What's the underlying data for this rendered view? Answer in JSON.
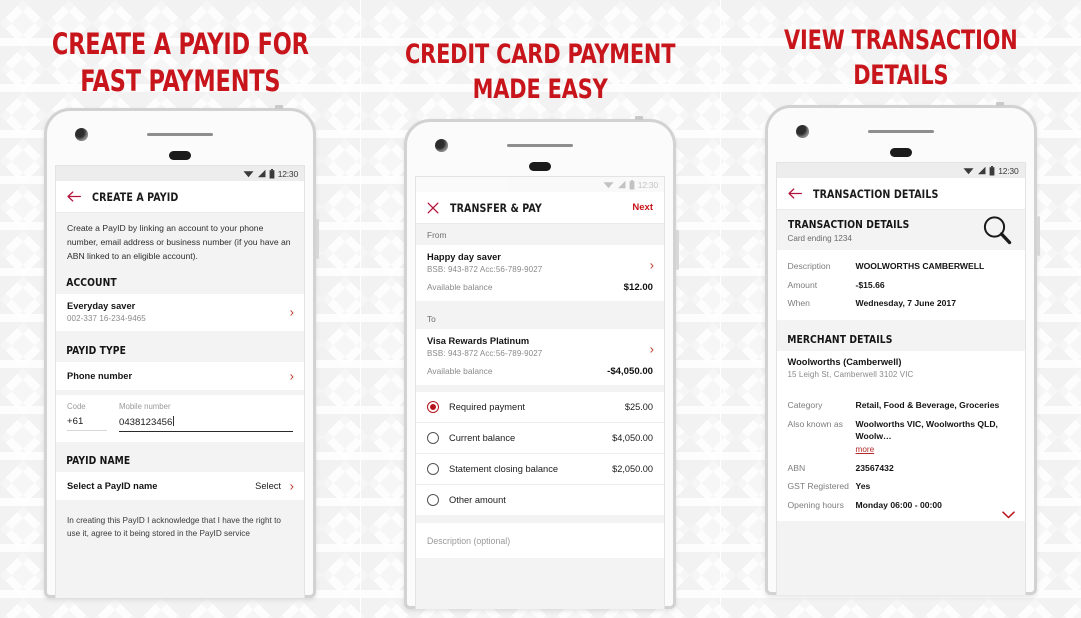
{
  "theme": {
    "brand_red": "#c7151b",
    "accent_red": "#b8131b",
    "chevron_red": "#c0392b"
  },
  "panels": [
    {
      "headline": "CREATE A PAYID FOR\nFAST PAYMENTS",
      "status": {
        "time": "12:30",
        "faded": false
      },
      "appbar": {
        "nav_icon": "back-arrow-icon",
        "title": "CREATE A PAYID",
        "action": ""
      },
      "intro": "Create a PayID by linking an account to your phone number, email address or business number (if you have an ABN linked to an eligible account).",
      "account_section": "ACCOUNT",
      "account": {
        "name": "Everyday saver",
        "detail": "002-337  16-234-9465"
      },
      "payid_type_section": "PAYID TYPE",
      "payid_type": {
        "name": "Phone number"
      },
      "code_label": "Code",
      "code_value": "+61",
      "mobile_label": "Mobile number",
      "mobile_value": "0438123456",
      "payid_name_section": "PAYID NAME",
      "payid_name": {
        "label": "Select a PayID name",
        "action": "Select"
      },
      "legal": "In creating this PayID I acknowledge that I have the right to use it, agree to it being stored in the PayID service"
    },
    {
      "headline": "CREDIT CARD PAYMENT\nMADE EASY",
      "status": {
        "time": "12:30",
        "faded": true
      },
      "appbar": {
        "nav_icon": "close-icon",
        "title": "TRANSFER & PAY",
        "action": "Next"
      },
      "from_label": "From",
      "from_account": {
        "name": "Happy day saver",
        "detail": "BSB: 943-872   Acc:56-789-9027",
        "balance_label": "Available balance",
        "balance": "$12.00"
      },
      "to_label": "To",
      "to_account": {
        "name": "Visa Rewards Platinum",
        "detail": "BSB: 943-872   Acc:56-789-9027",
        "balance_label": "Available balance",
        "balance": "-$4,050.00"
      },
      "options": [
        {
          "label": "Required payment",
          "amount": "$25.00",
          "selected": true
        },
        {
          "label": "Current balance",
          "amount": "$4,050.00",
          "selected": false
        },
        {
          "label": "Statement closing balance",
          "amount": "$2,050.00",
          "selected": false
        },
        {
          "label": "Other amount",
          "amount": "",
          "selected": false
        }
      ],
      "description_placeholder": "Description (optional)"
    },
    {
      "headline": "VIEW TRANSACTION\nDETAILS",
      "status": {
        "time": "12:30",
        "faded": false
      },
      "appbar": {
        "nav_icon": "back-arrow-icon",
        "title": "TRANSACTION DETAILS",
        "action": ""
      },
      "txn_section": "TRANSACTION DETAILS",
      "txn_card_ending": "Card ending 1234",
      "search_icon": "magnifier-icon",
      "txn_rows": [
        {
          "k": "Description",
          "v": "WOOLWORTHS CAMBERWELL"
        },
        {
          "k": "Amount",
          "v": "-$15.66"
        },
        {
          "k": "When",
          "v": "Wednesday, 7 June 2017"
        }
      ],
      "merchant_section": "MERCHANT DETAILS",
      "merchant_name": "Woolworths (Camberwell)",
      "merchant_address": "15 Leigh St, Camberwell 3102 VIC",
      "merchant_rows": [
        {
          "k": "Category",
          "v": "Retail, Food & Beverage, Groceries"
        },
        {
          "k": "Also known as",
          "v": "Woolworths VIC, Woolworths QLD, Woolw…",
          "more": "more"
        },
        {
          "k": "ABN",
          "v": "23567432"
        },
        {
          "k": "GST Registered",
          "v": "Yes"
        },
        {
          "k": "Opening hours",
          "v": "Monday 06:00 - 00:00"
        }
      ]
    }
  ]
}
